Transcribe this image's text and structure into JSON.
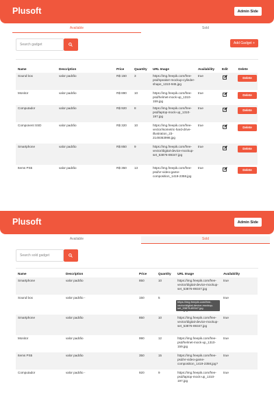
{
  "app": {
    "brand": "Plusoft",
    "admin_button": "Admin Side"
  },
  "tabs": [
    {
      "label": "Available"
    },
    {
      "label": "Sold"
    }
  ],
  "available_view": {
    "search_placeholder": "Search gadget",
    "add_button": "Add Gadget +",
    "columns": [
      "Name",
      "Description",
      "Price",
      "Quantity",
      "URL Image",
      "Availability",
      "Edit",
      "Delete"
    ],
    "delete_label": "Delete",
    "rows": [
      {
        "name": "Sound box",
        "description": "valor padrão",
        "price": "R$ 150",
        "quantity": "3",
        "url": "https://img.freepik.com/free-psd/speaker-mockup-cylinder-shape_1310-945.jpg",
        "availability": "true"
      },
      {
        "name": "Monitor",
        "description": "valor padrão",
        "price": "R$ 890",
        "quantity": "10",
        "url": "https://img.freepik.com/free-psd/helmet-mock-up_1310-159.jpg",
        "availability": "true"
      },
      {
        "name": "Computador",
        "description": "valor padrão",
        "price": "R$ 920",
        "quantity": "8",
        "url": "https://img.freepik.com/free-psd/laptop-mock-up_1310-197.jpg",
        "availability": "true"
      },
      {
        "name": "Component SSD",
        "description": "valor padrão",
        "price": "R$ 320",
        "quantity": "10",
        "url": "https://img.freepik.com/free-vector/isometric-hard-drive-illustration_23-2149363998.jpg",
        "availability": "true"
      },
      {
        "name": "Smartphone",
        "description": "valor padrão",
        "price": "R$ 850",
        "quantity": "9",
        "url": "https://img.freepik.com/free-vector/digital-device-mockup-set_53876-89347.jpg",
        "availability": "true"
      },
      {
        "name": "Items PS5",
        "description": "valor padrão",
        "price": "R$ 350",
        "quantity": "13",
        "url": "https://img.freepik.com/free-psd/vr-video-game-composition_1419-2358.jpg",
        "availability": "true"
      }
    ]
  },
  "sold_view": {
    "search_placeholder": "Search sold gadget",
    "columns": [
      "Name",
      "Description",
      "Price",
      "Quantity",
      "URL Image",
      "Availability"
    ],
    "tooltip": "https://img.freepik.com/free-vector/digital-device-mockup-set_53876-89347.jpg",
    "rows": [
      {
        "name": "Smartphone",
        "description": "valor padrão",
        "price": "850",
        "quantity": "10",
        "url": "https://img.freepik.com/free-vector/digital-device-mockup-set_53876-89347.jpg",
        "availability": "true"
      },
      {
        "name": "Sound box",
        "description": "valor padrão -",
        "price": "150",
        "quantity": "5",
        "url": "945.jpg?",
        "availability": "true"
      },
      {
        "name": "Smartphone",
        "description": "valor padrão",
        "price": "850",
        "quantity": "10",
        "url": "https://img.freepik.com/free-vector/digital-device-mockup-set_53876-89347.jpg",
        "availability": "true"
      },
      {
        "name": "Monitor",
        "description": "valor padrão",
        "price": "990",
        "quantity": "12",
        "url": "https://img.freepik.com/free-psd/helmet-mock-up_1310-159.jpg",
        "availability": "true"
      },
      {
        "name": "Items PS5",
        "description": "valor padrão",
        "price": "350",
        "quantity": "15",
        "url": "https://img.freepik.com/free-psd/vr-video-game-composition_1419-2358.jpg?",
        "availability": "true"
      },
      {
        "name": "Computador",
        "description": "valor padrão -",
        "price": "920",
        "quantity": "9",
        "url": "https://img.freepik.com/free-psd/laptop-mock-up_1310-197.jpg",
        "availability": "true"
      }
    ]
  },
  "colors": {
    "accent": "#f0573d",
    "row_alt": "#f2f2f2"
  }
}
